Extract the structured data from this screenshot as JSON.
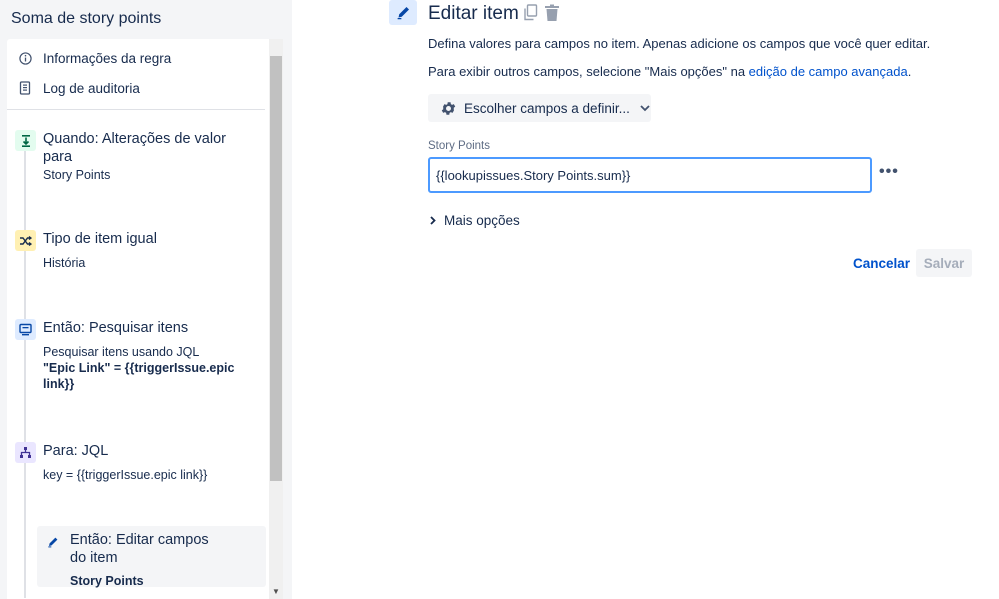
{
  "rule": {
    "title": "Soma de story points",
    "menu": [
      {
        "label": "Informações da regra",
        "icon": "info-icon"
      },
      {
        "label": "Log de auditoria",
        "icon": "clipboard-icon"
      }
    ],
    "steps": [
      {
        "title": "Quando: Alterações de valor para",
        "subtitle": "Story Points",
        "icon": "trigger-icon",
        "color": "#e3fcef"
      },
      {
        "title": "Tipo de item igual",
        "subtitle": "História",
        "icon": "shuffle-icon",
        "color": "#fff0b3"
      },
      {
        "title": "Então: Pesquisar itens",
        "subtitle": "Pesquisar itens usando JQL",
        "bold": "\"Epic Link\" = {{triggerIssue.epic link}}",
        "icon": "lookup-icon",
        "color": "#deebff"
      },
      {
        "title": "Para: JQL",
        "subtitle": "key = {{triggerIssue.epic link}}",
        "icon": "branch-icon",
        "color": "#eae6ff"
      },
      {
        "title": "Então: Editar campos do item",
        "bold": "Story Points",
        "icon": "pencil-icon",
        "color": "#deebff"
      }
    ]
  },
  "editor": {
    "title": "Editar item",
    "description": "Defina valores para campos no item. Apenas adicione os campos que você quer editar.",
    "more_info_prefix": "Para exibir outros campos, selecione \"Mais opções\" na ",
    "more_info_link": "edição de campo avançada",
    "more_info_suffix": ".",
    "choose_fields_label": "Escolher campos a definir...",
    "field_label": "Story Points",
    "field_value": "{{lookupissues.Story Points.sum}}",
    "more_options_label": "Mais opções",
    "cancel_label": "Cancelar",
    "save_label": "Salvar"
  },
  "colors": {
    "accent": "#0052cc",
    "focus_border": "#4c9aff",
    "panel_bg": "#f4f5f7"
  }
}
